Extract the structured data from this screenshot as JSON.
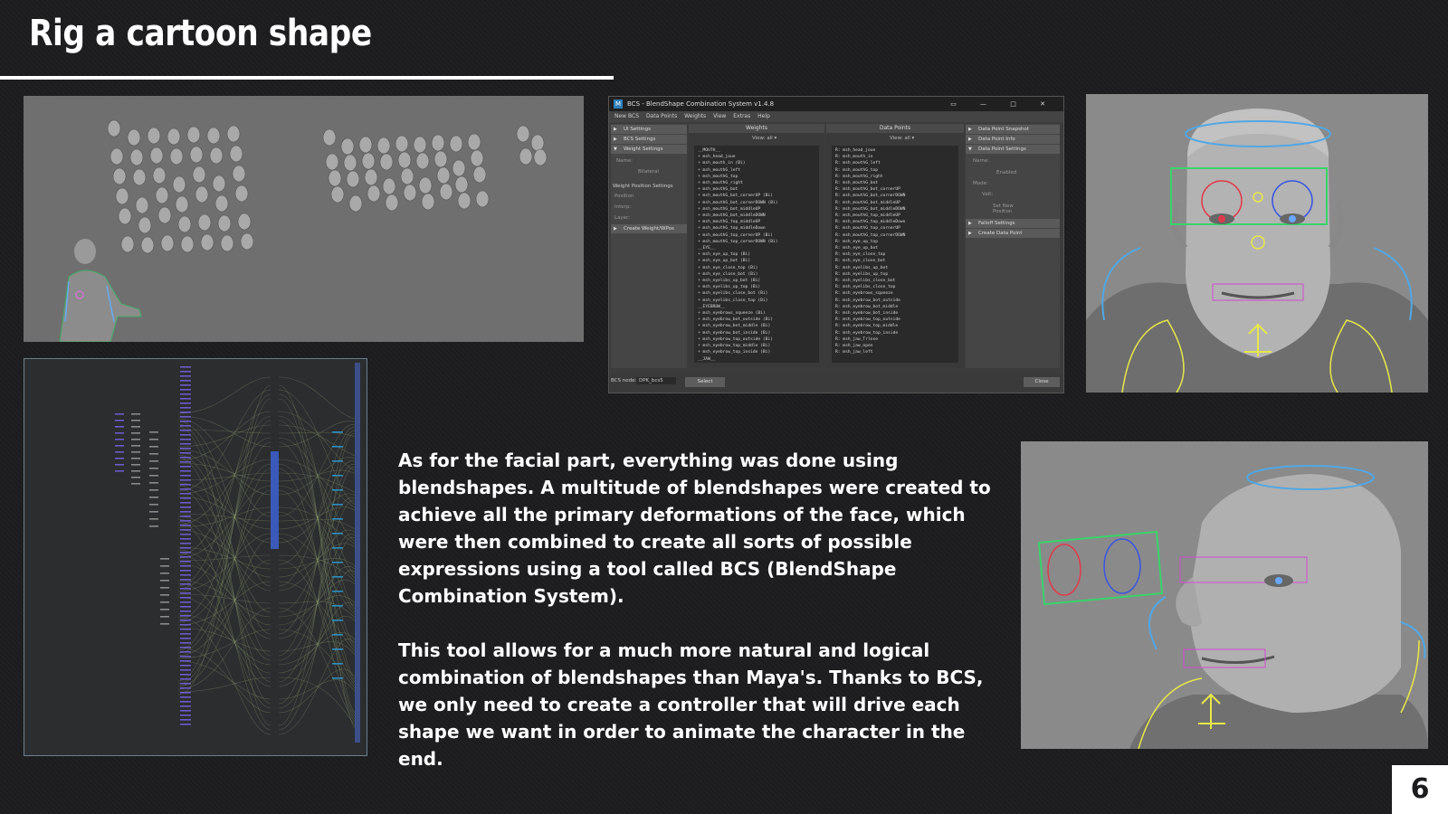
{
  "slide": {
    "title": "Rig a cartoon shape",
    "paragraphs": [
      "As for the facial part, everything was done using blendshapes. A multitude of blendshapes were created to achieve all the primary deformations of the face, which were then combined to create all sorts of possible expressions using a tool called BCS (BlendShape Combination System).",
      "This tool allows for a much more natural and logical combination of blendshapes than Maya's. Thanks to BCS, we only need to create a controller that will drive each shape we want in order to animate the character in the end."
    ],
    "page_number": "6"
  },
  "bcs": {
    "window_title": "BCS - BlendShape Combination System   v1.4.8",
    "app_icon": "M",
    "menu": [
      "New BCS",
      "Data Points",
      "Weights",
      "View",
      "Extras",
      "Help"
    ],
    "left_sections": [
      "UI Settings",
      "BCS Settings",
      "Weight Settings",
      "Name:",
      "Bilateral",
      "Weight Position Settings",
      "Position",
      "Interp:",
      "Layer:",
      "Create Weight/WPos"
    ],
    "weights_header": "Weights",
    "datapoints_header": "Data Points",
    "view_label": "View:",
    "view_value": "all",
    "weights_list": [
      "__MOUTH__",
      "+ msh_head_joue",
      "+ msh_mouth_in (Bi)",
      "+ msh_mouthG_left",
      "+ msh_mouthG_top",
      "+ msh_mouthG_right",
      "+ msh_mouthG_bot",
      "+ msh_mouthG_bot_cornerUP (Bi)",
      "+ msh_mouthG_bot_cornerDOWN (Bi)",
      "+ msh_mouthG_bot_middleUP",
      "+ msh_mouthG_bot_middleDOWN",
      "+ msh_mouthG_top_middleUP",
      "+ msh_mouthG_top_middleDown",
      "+ msh_mouthG_top_cornerUP (Bi)",
      "+ msh_mouthG_top_cornerDOWN (Bi)",
      "__EYE__",
      "+ msh_eye_up_top (Bi)",
      "+ msh_eye_up_bot (Bi)",
      "+ msh_eye_close_top (Bi)",
      "+ msh_eye_close_bot (Bi)",
      "+ msh_eyelibs_up_bot (Bi)",
      "+ msh_eyelibs_up_top (Bi)",
      "+ msh_eyelibs_close_bot (Bi)",
      "+ msh_eyelibs_close_top (Bi)",
      "__EYEBROW__",
      "+ msh_eyebrows_squeeze (Bi)",
      "+ msh_eyebrow_bot_outside (Bi)",
      "+ msh_eyebrow_bot_middle (Bi)",
      "+ msh_eyebrow_bot_inside (Bi)",
      "+ msh_eyebrow_top_outside (Bi)",
      "+ msh_eyebrow_top_middle (Bi)",
      "+ msh_eyebrow_top_inside (Bi)",
      "__JAW__"
    ],
    "datapoints_list": [
      "R: msh_head_joue",
      "R: msh_mouth_in",
      "R: msh_mouthG_left",
      "R: msh_mouthG_top",
      "R: msh_mouthG_right",
      "R: msh_mouthG_bot",
      "R: msh_mouthG_bot_cornerUP",
      "R: msh_mouthG_bot_cornerDOWN",
      "R: msh_mouthG_bot_middleUP",
      "R: msh_mouthG_bot_middleDOWN",
      "R: msh_mouthG_top_middleUP",
      "R: msh_mouthG_top_middleDown",
      "R: msh_mouthG_top_cornerUP",
      "R: msh_mouthG_top_cornerDOWN",
      "R: msh_eye_up_top",
      "R: msh_eye_up_bot",
      "R: msh_eye_close_top",
      "R: msh_eye_close_bot",
      "R: msh_eyelibs_up_bot",
      "R: msh_eyelibs_up_top",
      "R: msh_eyelibs_close_bot",
      "R: msh_eyelibs_close_top",
      "R: msh_eyebrows_squeeze",
      "R: msh_eyebrow_bot_outside",
      "R: msh_eyebrow_bot_middle",
      "R: msh_eyebrow_bot_inside",
      "R: msh_eyebrow_top_outside",
      "R: msh_eyebrow_top_middle",
      "R: msh_eyebrow_top_inside",
      "R: msh_jaw_Trlnse",
      "R: msh_jaw_open",
      "R: msh_jaw_left"
    ],
    "right_sections": [
      "Data Point Snapshot",
      "Data Point Info",
      "Data Point Settings",
      "Name:",
      "Enabled",
      "Mode:",
      "Valt:",
      "Set New Position",
      "Falloff Settings",
      "Create Data Point"
    ],
    "bcs_node_label": "BCS node:",
    "bcs_node_value": "DPK_bcs5",
    "select_label": "Select",
    "close_label": "Close"
  }
}
